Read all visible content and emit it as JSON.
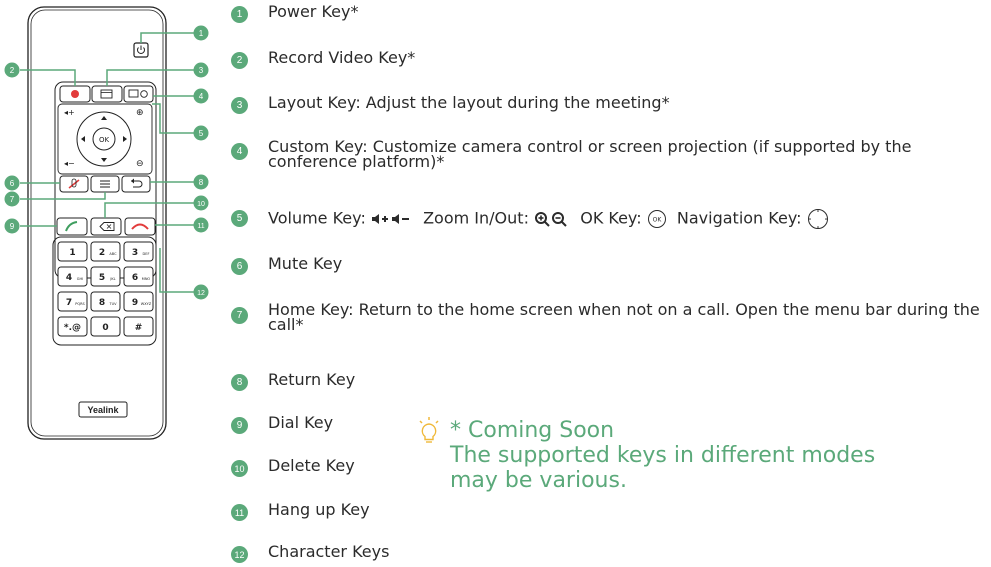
{
  "callout_numbers": [
    "1",
    "2",
    "3",
    "4",
    "5",
    "6",
    "7",
    "8",
    "9",
    "10",
    "11",
    "12"
  ],
  "remote": {
    "brand": "Yealink",
    "ok_label": "OK",
    "keypad": [
      {
        "digit": "1",
        "letters": ""
      },
      {
        "digit": "2",
        "letters": "ABC"
      },
      {
        "digit": "3",
        "letters": "DEF"
      },
      {
        "digit": "4",
        "letters": "GHI"
      },
      {
        "digit": "5",
        "letters": "JKL"
      },
      {
        "digit": "6",
        "letters": "MNO"
      },
      {
        "digit": "7",
        "letters": "PQRS"
      },
      {
        "digit": "8",
        "letters": "TUV"
      },
      {
        "digit": "9",
        "letters": "WXYZ"
      },
      {
        "digit": "*.@",
        "letters": ""
      },
      {
        "digit": "0",
        "letters": ""
      },
      {
        "digit": "#",
        "letters": ""
      }
    ]
  },
  "legend": [
    {
      "num": "1",
      "text": "Power Key*"
    },
    {
      "num": "2",
      "text": "Record Video Key*"
    },
    {
      "num": "3",
      "text": "Layout Key: Adjust the layout during the meeting*"
    },
    {
      "num": "4",
      "text": "Custom Key: Customize camera control or screen projection (if supported by the conference platform)*"
    },
    {
      "num": "5",
      "text_volume": "Volume Key:",
      "text_zoom": "Zoom In/Out:",
      "text_ok": "OK Key:",
      "text_nav": "Navigation Key:"
    },
    {
      "num": "6",
      "text": "Mute Key"
    },
    {
      "num": "7",
      "text": "Home Key: Return to the home screen when not on a call. Open the menu bar during the call*"
    },
    {
      "num": "8",
      "text": "Return Key"
    },
    {
      "num": "9",
      "text": "Dial Key"
    },
    {
      "num": "10",
      "text": "Delete Key"
    },
    {
      "num": "11",
      "text": "Hang up Key"
    },
    {
      "num": "12",
      "text": "Character Keys"
    }
  ],
  "note": {
    "title": "* Coming Soon",
    "body": "The supported keys in different modes may be various."
  },
  "colors": {
    "accent": "#5ba97a",
    "record": "#e23b3b",
    "hangup": "#e23b3b",
    "dial": "#3f9e5f",
    "outline": "#222222"
  }
}
